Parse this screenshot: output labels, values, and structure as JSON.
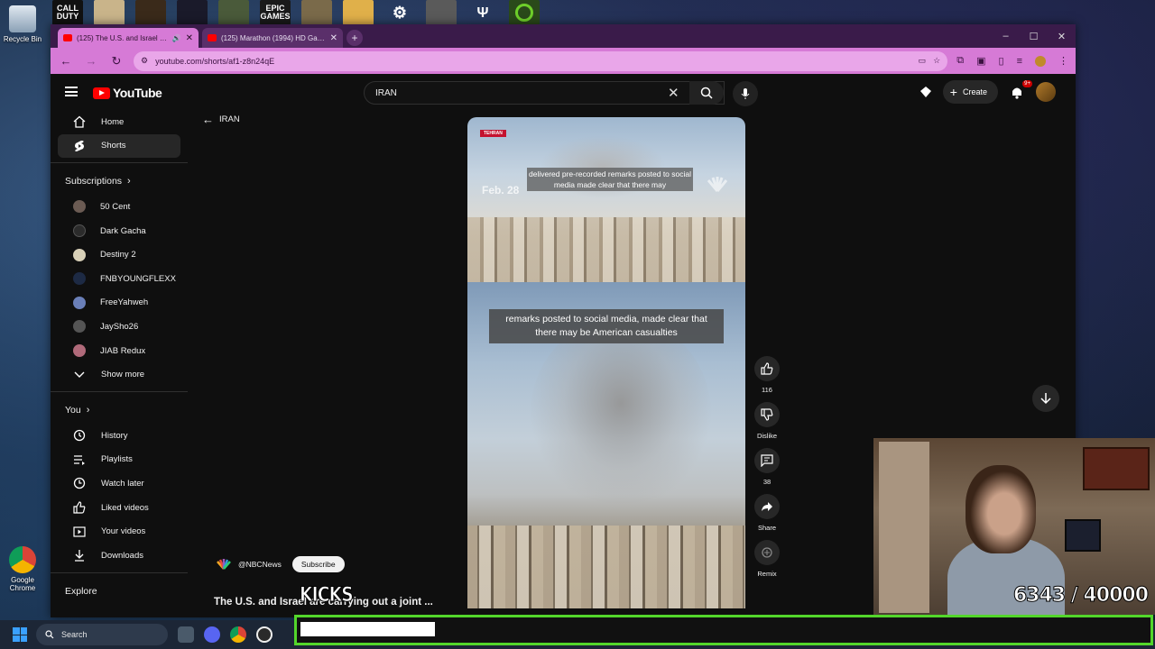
{
  "desktop": {
    "top_app_labels": [
      "CALL DUTY",
      "",
      "",
      "",
      "",
      "EPIC GAMES",
      "",
      "",
      "",
      "",
      "",
      ""
    ],
    "recycle_bin_label": "Recycle Bin",
    "chrome_label": "Google Chrome"
  },
  "browser": {
    "tabs": [
      {
        "title": "(125) The U.S. and Israel are",
        "active": true
      },
      {
        "title": "(125) Marathon (1994) HD Game",
        "active": false
      }
    ],
    "url": "youtube.com/shorts/af1-z8n24qE",
    "window_controls": [
      "–",
      "☐",
      "✕"
    ]
  },
  "youtube": {
    "logo_text": "YouTube",
    "search_value": "IRAN",
    "create_label": "Create",
    "notif_badge": "9+",
    "back_label": "IRAN",
    "sidebar": {
      "main": [
        {
          "label": "Home",
          "icon": "home-icon"
        },
        {
          "label": "Shorts",
          "icon": "shorts-icon",
          "active": true
        }
      ],
      "subscriptions_header": "Subscriptions",
      "subscriptions": [
        {
          "label": "50 Cent",
          "color": "#6b5b53"
        },
        {
          "label": "Dark Gacha",
          "color": "#2b2b2b"
        },
        {
          "label": "Destiny 2",
          "color": "#d8d0b8"
        },
        {
          "label": "FNBYOUNGFLEXX",
          "color": "#1d2a44"
        },
        {
          "label": "FreeYahweh",
          "color": "#6a7fb8"
        },
        {
          "label": "JaySho26",
          "color": "#555555"
        },
        {
          "label": "JIAB Redux",
          "color": "#b06a7a"
        }
      ],
      "show_more": "Show more",
      "you_header": "You",
      "you_items": [
        {
          "label": "History",
          "icon": "history-icon"
        },
        {
          "label": "Playlists",
          "icon": "playlists-icon"
        },
        {
          "label": "Watch later",
          "icon": "watch-later-icon"
        },
        {
          "label": "Liked videos",
          "icon": "liked-icon"
        },
        {
          "label": "Your videos",
          "icon": "your-videos-icon"
        },
        {
          "label": "Downloads",
          "icon": "downloads-icon"
        }
      ],
      "explore_header": "Explore"
    },
    "short": {
      "location_tag": "TEHRAN",
      "date_overlay": "Feb. 28",
      "caption_top": "delivered pre-recorded remarks posted to social media made clear that there may",
      "caption_bottom": "remarks posted to social media, made clear that there may be American casualties",
      "channel": "@NBCNews",
      "subscribe": "Subscribe",
      "title": "The U.S. and Israel are carrying out a joint ..."
    },
    "actions": {
      "like_count": "116",
      "dislike_label": "Dislike",
      "comment_count": "38",
      "share_label": "Share",
      "remix_label": "Remix"
    }
  },
  "stream_overlay": {
    "kicks_label": "KICKS",
    "counter": "6343  / 40000",
    "goal_current": 6343,
    "goal_target": 40000
  },
  "taskbar": {
    "search_label": "Search"
  }
}
